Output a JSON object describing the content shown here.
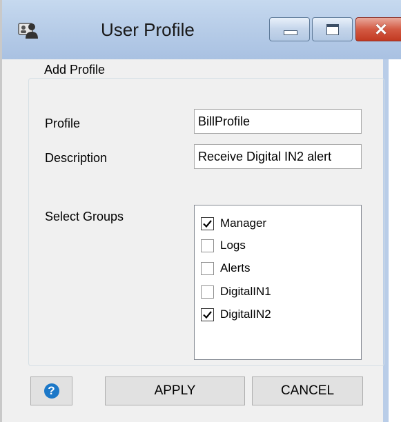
{
  "window": {
    "title": "User Profile",
    "icons": {
      "app": "user-profile-icon",
      "minimize": "minimize-icon",
      "maximize": "maximize-icon",
      "close": "close-icon"
    }
  },
  "groupbox": {
    "title": "Add Profile"
  },
  "form": {
    "profile_label": "Profile",
    "profile_value": "BillProfile",
    "description_label": "Description",
    "description_value": "Receive Digital IN2 alert",
    "groups_label": "Select Groups"
  },
  "groups": [
    {
      "label": "Manager",
      "checked": true
    },
    {
      "label": "Logs",
      "checked": false
    },
    {
      "label": "Alerts",
      "checked": false
    },
    {
      "label": "DigitalIN1",
      "checked": false
    },
    {
      "label": "DigitalIN2",
      "checked": true
    }
  ],
  "buttons": {
    "help_icon": "help-icon",
    "help_glyph": "?",
    "apply_label": "APPLY",
    "cancel_label": "CANCEL"
  },
  "colors": {
    "titlebar": "#b5cbe7",
    "close_button": "#c94a35",
    "help_icon": "#1c78c8"
  }
}
